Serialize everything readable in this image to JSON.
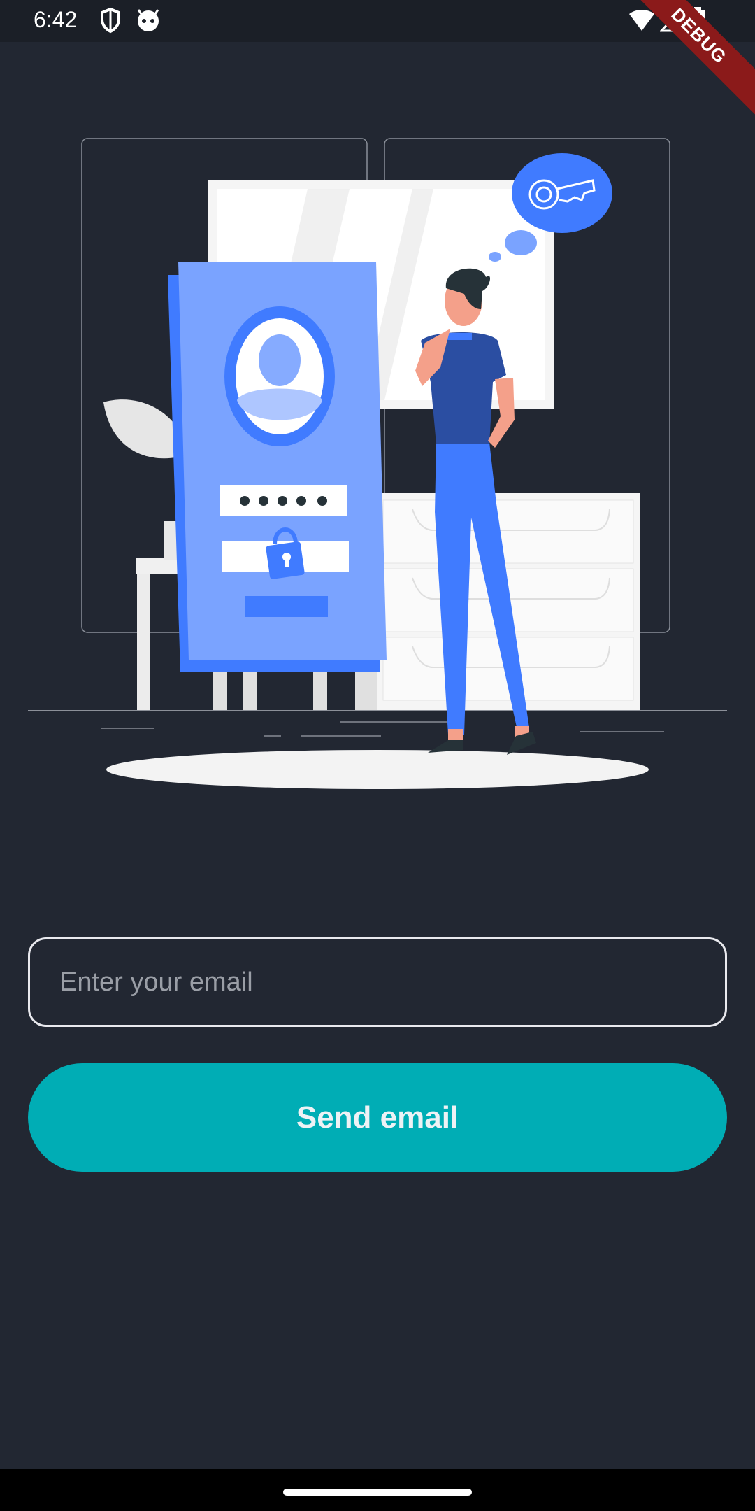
{
  "status_bar": {
    "time": "6:42",
    "icons": [
      "shield-icon",
      "android-face-icon",
      "wifi-icon",
      "signal-icon",
      "battery-icon"
    ]
  },
  "debug_banner": {
    "label": "DEBUG"
  },
  "illustration": {
    "description_icons": [
      "login-phone-icon",
      "key-icon",
      "person-thinking-icon"
    ],
    "colors": {
      "accent_blue": "#407bff",
      "light_blue": "#7aa3ff",
      "skin": "#f4a08a"
    }
  },
  "form": {
    "email_placeholder": "Enter your email",
    "email_value": "",
    "send_label": "Send email"
  },
  "colors": {
    "background": "#222732",
    "button": "#00adb5",
    "field_border": "#e9e9ee"
  }
}
